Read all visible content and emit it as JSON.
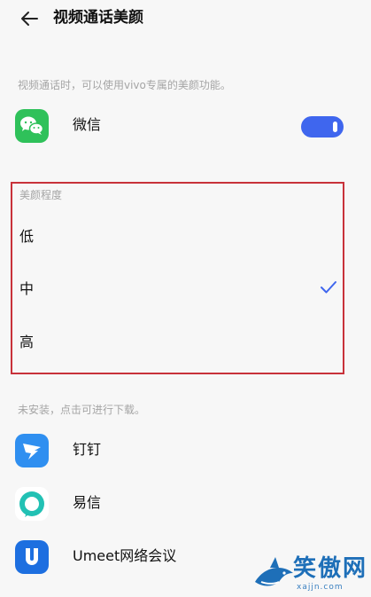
{
  "header": {
    "title": "视频通话美颜",
    "back_icon": "back-arrow-icon"
  },
  "intro_hint": "视频通话时，可以使用vivo专属的美颜功能。",
  "installed_apps": [
    {
      "name": "微信",
      "icon": "wechat-icon",
      "enabled": true
    }
  ],
  "beauty_level": {
    "header": "美颜程度",
    "options": [
      "低",
      "中",
      "高"
    ],
    "selected": "中"
  },
  "not_installed_hint": "未安装，点击可进行下载。",
  "uninstalled_apps": [
    {
      "name": "钉钉",
      "icon": "dingtalk-icon"
    },
    {
      "name": "易信",
      "icon": "yixin-icon"
    },
    {
      "name": "Umeet网络会议",
      "icon": "umeet-icon"
    }
  ],
  "watermark": {
    "text": "笑傲网",
    "sub": "xajjn.com"
  },
  "colors": {
    "accent": "#3f66ee",
    "highlight_border": "#c8323a",
    "hint": "#a5a5a5"
  }
}
